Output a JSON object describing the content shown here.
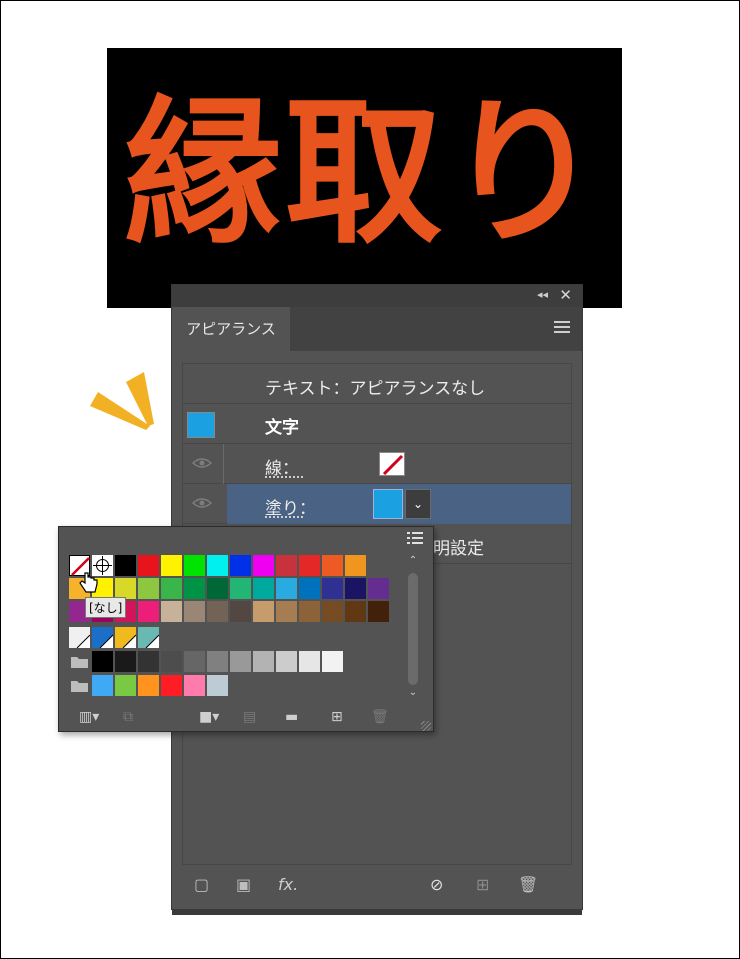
{
  "banner": {
    "text": "縁取り",
    "text_color": "#E8541D",
    "background": "#000000"
  },
  "panel": {
    "tab": "アピアランス",
    "rows": {
      "header": "テキスト：アピアランスなし",
      "character": "文字",
      "stroke_label": "線：",
      "fill_label": "塗り：",
      "opacity_partial": "明設定"
    },
    "fill_color": "#1BA1E2",
    "footer_fx": "fx."
  },
  "popup": {
    "tooltip": "[なし]",
    "rows": [
      [
        "none",
        "registration",
        "#000000",
        "#E8141C",
        "#FFF200",
        "#00E200",
        "#00F0F0",
        "#0030E8",
        "#F000F0",
        "#C8323C",
        "#E42828",
        "#EE5A24",
        "#F0961E"
      ],
      [
        "#F7B22C",
        "#FFF200",
        "#D8D828",
        "#8DC63F",
        "#39B54A",
        "#009245",
        "#006837",
        "#22B573",
        "#00A99D",
        "#29ABE2",
        "#0071BC",
        "#2E3192",
        "#1B1464",
        "#662D91"
      ],
      [
        "#93278F",
        "#9E005D",
        "#D4145A",
        "#ED1E79",
        "#C7B299",
        "#998675",
        "#736357",
        "#534741",
        "#C69C6D",
        "#A67C52",
        "#8C6239",
        "#754C24",
        "#603813",
        "#42210B"
      ],
      [
        "grad-white",
        "grad-blue",
        "grad-yellow",
        "grad-teal"
      ],
      [
        "folder",
        "#000000",
        "#1A1A1A",
        "#333333",
        "#4D4D4D",
        "#666666",
        "#808080",
        "#999999",
        "#B3B3B3",
        "#CCCCCC",
        "#E6E6E6",
        "#F2F2F2"
      ],
      [
        "folder",
        "#3FA9F5",
        "#7AC943",
        "#FF931E",
        "#FF1D25",
        "#FF7BAC",
        "#BDCCD4"
      ]
    ]
  }
}
